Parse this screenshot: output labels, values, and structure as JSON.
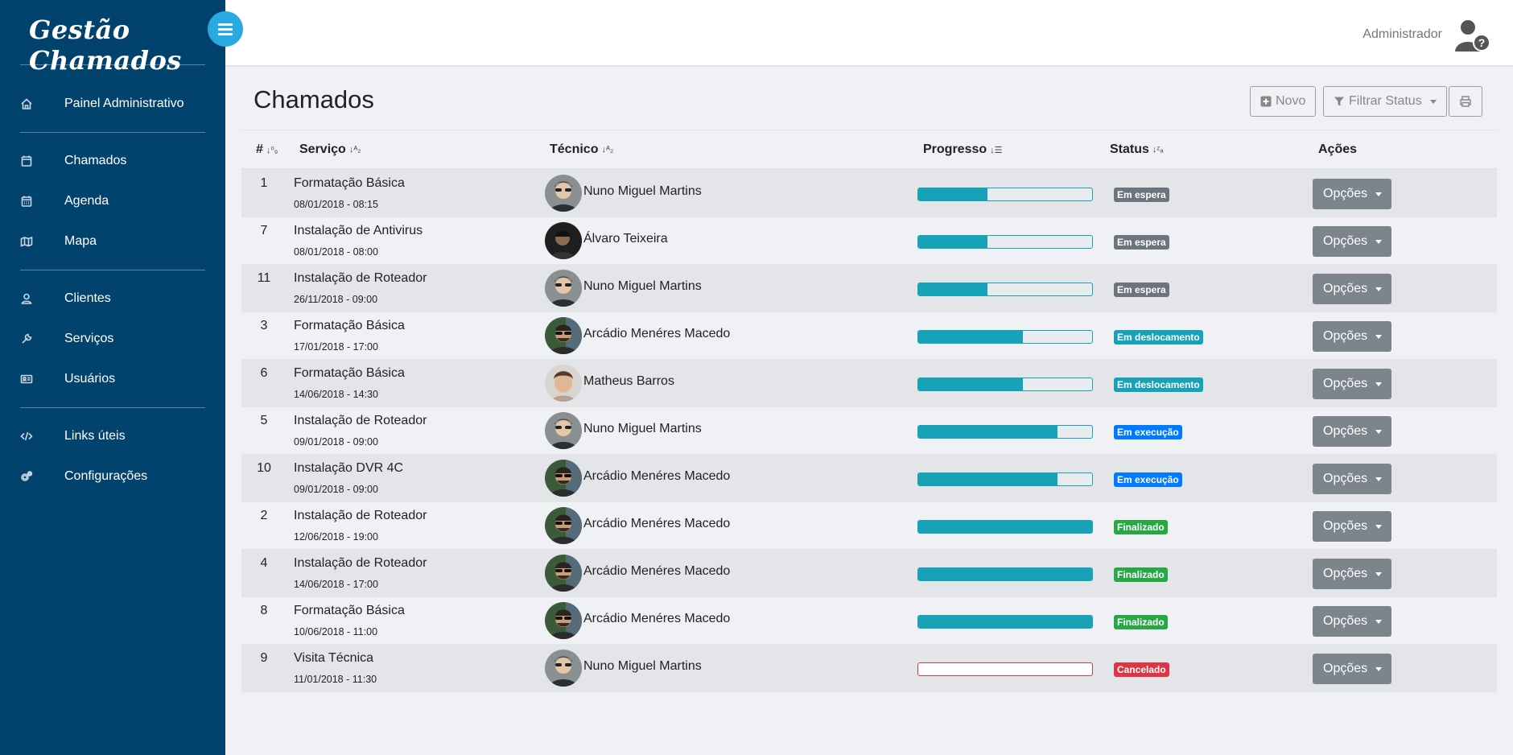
{
  "app": {
    "brand": "Gestão Chamados",
    "user": "Administrador"
  },
  "sidebar": {
    "items": [
      {
        "label": "Painel Administrativo",
        "icon": "home-icon"
      },
      {
        "label": "Chamados",
        "icon": "calendar-blank-icon"
      },
      {
        "label": "Agenda",
        "icon": "calendar-icon"
      },
      {
        "label": "Mapa",
        "icon": "map-icon"
      },
      {
        "label": "Clientes",
        "icon": "user-icon"
      },
      {
        "label": "Serviços",
        "icon": "wrench-icon"
      },
      {
        "label": "Usuários",
        "icon": "id-card-icon"
      },
      {
        "label": "Links úteis",
        "icon": "code-icon"
      },
      {
        "label": "Configurações",
        "icon": "gears-icon"
      }
    ]
  },
  "page": {
    "title": "Chamados",
    "new_label": "Novo",
    "filter_label": "Filtrar Status"
  },
  "table": {
    "headers": {
      "id": "#",
      "service": "Serviço",
      "tech": "Técnico",
      "progress": "Progresso",
      "status": "Status",
      "actions": "Ações"
    },
    "options_label": "Opções",
    "rows": [
      {
        "id": "1",
        "service": "Formatação Básica",
        "date": "08/01/2018 - 08:15",
        "tech": "Nuno Miguel Martins",
        "progress": 0.4,
        "status": "Em espera",
        "status_color": "#6c757d",
        "avatar": "nuno"
      },
      {
        "id": "7",
        "service": "Instalação de Antivirus",
        "date": "08/01/2018 - 08:00",
        "tech": "Álvaro Teixeira",
        "progress": 0.4,
        "status": "Em espera",
        "status_color": "#6c757d",
        "avatar": "alvaro"
      },
      {
        "id": "11",
        "service": "Instalação de Roteador",
        "date": "26/11/2018 - 09:00",
        "tech": "Nuno Miguel Martins",
        "progress": 0.4,
        "status": "Em espera",
        "status_color": "#6c757d",
        "avatar": "nuno"
      },
      {
        "id": "3",
        "service": "Formatação Básica",
        "date": "17/01/2018 - 17:00",
        "tech": "Arcádio Menéres Macedo",
        "progress": 0.6,
        "status": "Em deslocamento",
        "status_color": "#17a2b8",
        "avatar": "arcadio"
      },
      {
        "id": "6",
        "service": "Formatação Básica",
        "date": "14/06/2018 - 14:30",
        "tech": "Matheus Barros",
        "progress": 0.6,
        "status": "Em deslocamento",
        "status_color": "#17a2b8",
        "avatar": "matheus"
      },
      {
        "id": "5",
        "service": "Instalação de Roteador",
        "date": "09/01/2018 - 09:00",
        "tech": "Nuno Miguel Martins",
        "progress": 0.8,
        "status": "Em execução",
        "status_color": "#007bff",
        "avatar": "nuno"
      },
      {
        "id": "10",
        "service": "Instalação DVR 4C",
        "date": "09/01/2018 - 09:00",
        "tech": "Arcádio Menéres Macedo",
        "progress": 0.8,
        "status": "Em execução",
        "status_color": "#007bff",
        "avatar": "arcadio"
      },
      {
        "id": "2",
        "service": "Instalação de Roteador",
        "date": "12/06/2018 - 19:00",
        "tech": "Arcádio Menéres Macedo",
        "progress": 1.0,
        "status": "Finalizado",
        "status_color": "#28a745",
        "avatar": "arcadio"
      },
      {
        "id": "4",
        "service": "Instalação de Roteador",
        "date": "14/06/2018 - 17:00",
        "tech": "Arcádio Menéres Macedo",
        "progress": 1.0,
        "status": "Finalizado",
        "status_color": "#28a745",
        "avatar": "arcadio"
      },
      {
        "id": "8",
        "service": "Formatação Básica",
        "date": "10/06/2018 - 11:00",
        "tech": "Arcádio Menéres Macedo",
        "progress": 1.0,
        "status": "Finalizado",
        "status_color": "#28a745",
        "avatar": "arcadio"
      },
      {
        "id": "9",
        "service": "Visita Técnica",
        "date": "11/01/2018 - 11:30",
        "tech": "Nuno Miguel Martins",
        "progress": 0.0,
        "status": "Cancelado",
        "status_color": "#dc3545",
        "avatar": "nuno"
      }
    ]
  }
}
